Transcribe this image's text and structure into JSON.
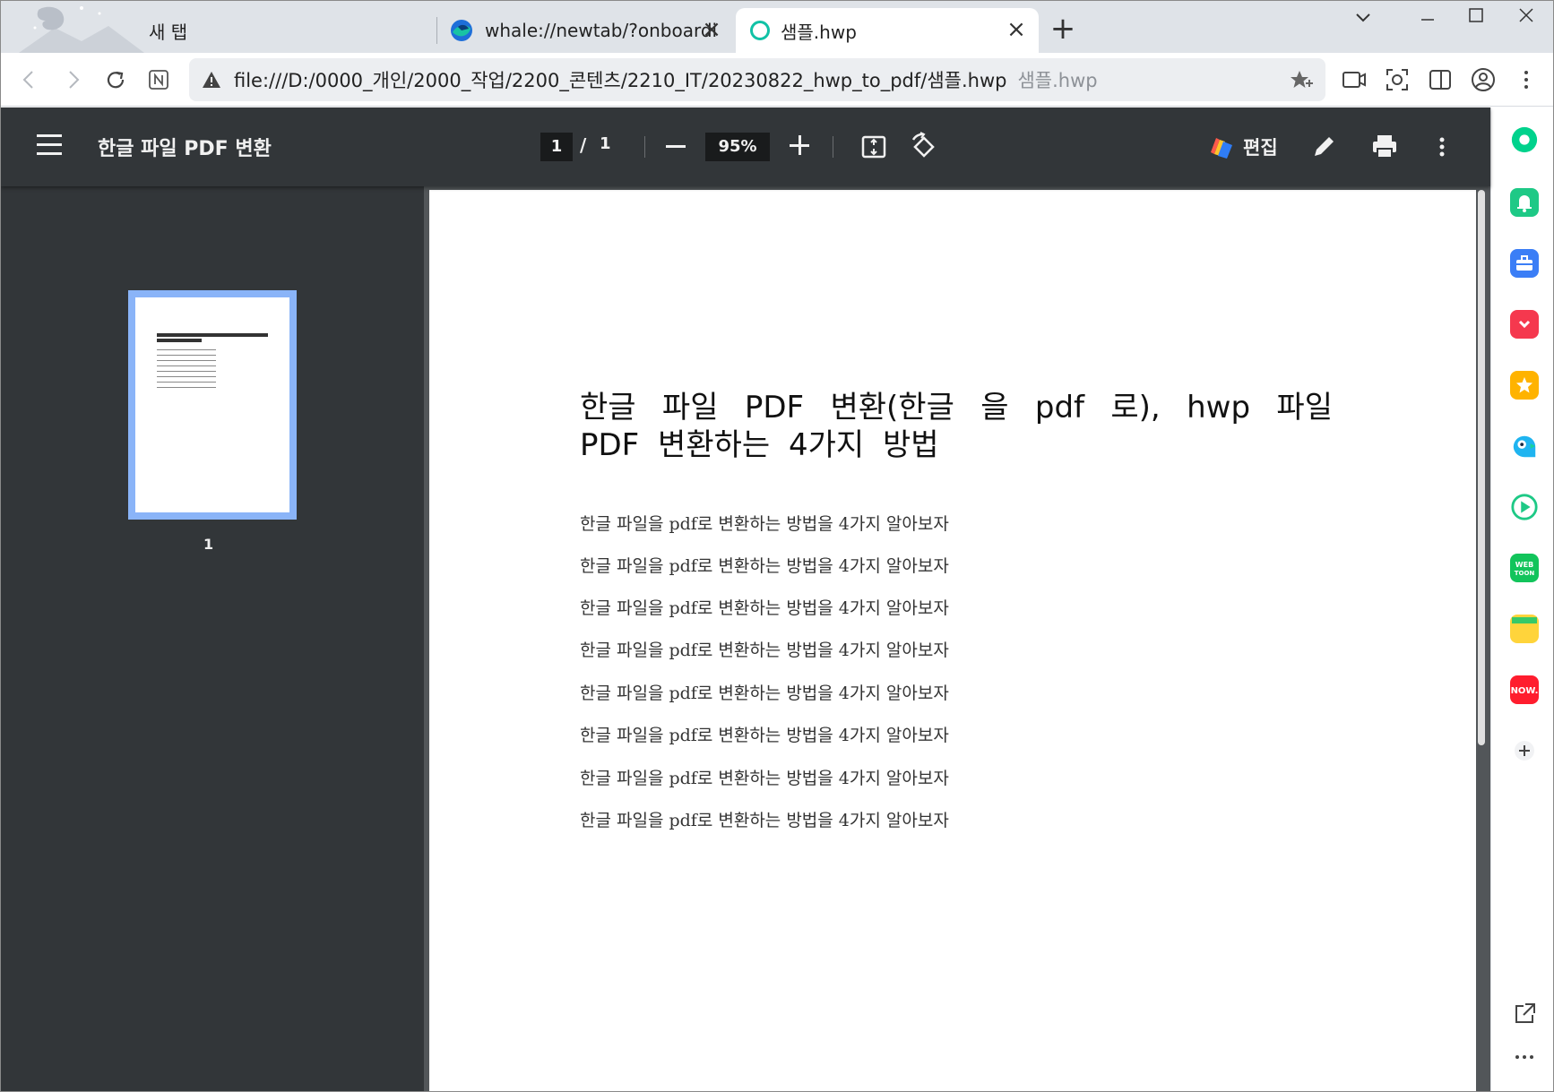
{
  "browser": {
    "tabs": [
      {
        "label": "새 탭",
        "active": false
      },
      {
        "label": "whale://newtab/?onboarding",
        "active": false
      },
      {
        "label": "샘플.hwp",
        "active": true
      }
    ],
    "address": {
      "url": "file:///D:/0000_개인/2000_작업/2200_콘텐츠/2210_IT/20230822_hwp_to_pdf/샘플.hwp",
      "hint": "샘플.hwp"
    },
    "colors": {
      "accent": "#11c2a6",
      "thumb_border": "#8ab4f8",
      "pdf_toolbar": "#323639",
      "pdf_bg": "#525659"
    }
  },
  "pdf": {
    "title": "한글 파일 PDF 변환",
    "page_current": "1",
    "page_separator": "/",
    "page_total": "1",
    "zoom": "95%",
    "edit_label": "편집",
    "thumb_page_number": "1"
  },
  "document": {
    "title": "한글 파일 PDF 변환(한글 을 pdf 로), hwp 파일 PDF 변환하는 4가지 방법",
    "lines": [
      "한글 파일을 pdf로 변환하는 방법을 4가지 알아보자",
      "한글 파일을 pdf로 변환하는 방법을 4가지 알아보자",
      "한글 파일을 pdf로 변환하는 방법을 4가지 알아보자",
      "한글 파일을 pdf로 변환하는 방법을 4가지 알아보자",
      "한글 파일을 pdf로 변환하는 방법을 4가지 알아보자",
      "한글 파일을 pdf로 변환하는 방법을 4가지 알아보자",
      "한글 파일을 pdf로 변환하는 방법을 4가지 알아보자",
      "한글 파일을 pdf로 변환하는 방법을 4가지 알아보자"
    ]
  },
  "sidebar_icons": [
    "green-ring-icon",
    "bell-icon",
    "briefcase-icon",
    "pocket-icon",
    "star-icon",
    "papago-icon",
    "play-icon",
    "webtoon-icon",
    "memo-icon",
    "now-icon",
    "add-icon"
  ]
}
